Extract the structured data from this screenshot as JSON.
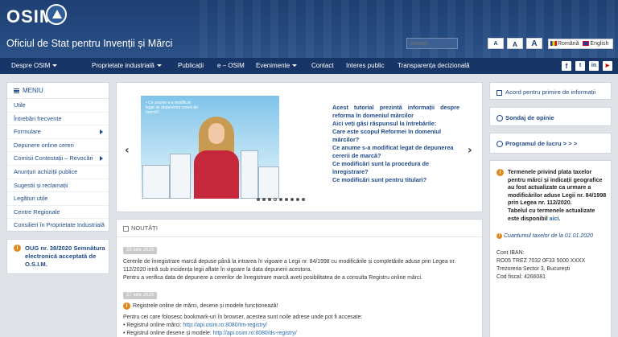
{
  "header": {
    "logo_text": "OSIM",
    "site_title": "Oficiul de Stat pentru Invenții și Mărci",
    "search_placeholder": "Search",
    "font_sizes": [
      "A",
      "A",
      "A"
    ],
    "languages": [
      "Română",
      "English"
    ]
  },
  "nav": {
    "items": [
      {
        "label": "Despre OSIM",
        "dropdown": true
      },
      {
        "label": "Proprietate industrială",
        "dropdown": true
      },
      {
        "label": "Publicații",
        "dropdown": false
      },
      {
        "label": "e – OSIM",
        "dropdown": false
      },
      {
        "label": "Evenimente",
        "dropdown": true
      },
      {
        "label": "Contact",
        "dropdown": false
      },
      {
        "label": "Interes public",
        "dropdown": false
      },
      {
        "label": "Transparența decizională",
        "dropdown": false
      }
    ],
    "social": [
      "f",
      "t",
      "in",
      "▶"
    ]
  },
  "menu": {
    "title": "MENIU",
    "items": [
      "Utile",
      "Întrebări frecvente",
      "Formulare",
      "Depunere online cereri",
      "Comisii Contestații – Revocări",
      "Anunțuri achiziții publice",
      "Sugestii și reclamații",
      "Legături utile",
      "Centre Regionale",
      "Consilieri în Proprietate Industrială"
    ]
  },
  "oug": {
    "text": "OUG nr. 38/2020 Semnătura electronică acceptată de O.S.I.M."
  },
  "slider": {
    "caption": "• Ce anume s-a modificat legat de depunerea cererii de marcă?",
    "lines": [
      "Acest tutorial prezintă informații despre reforma în domeniul mărcilor",
      "Aici veți găsi răspunsul la întrebările:",
      "Care este scopul Reformei în domeniul mărcilor?",
      "Ce anume s-a modificat legat de depunerea cererii de marcă?",
      "Ce modificări sunt la procedura de înregistrare?",
      "Ce modificări sunt pentru titulari?"
    ],
    "dot_count": 9,
    "active_dot": 3
  },
  "news": {
    "title": "NOUTĂȚI",
    "items": [
      {
        "date": "28 iulie 2020",
        "text1": "Cererile de înregistrare marcă depuse până la intrarea în vigoare a Legii nr. 84/1998 cu modificările și completările aduse prin Legea nr. 112/2020 intră sub incidența legii aflate în vigoare la data depunerii acestora.",
        "text2": "Pentru a verifica data de depunere a cererilor de înregistrare marcă aveți posibilitatea de a consulta Registru online mărci."
      },
      {
        "date": "27 iulie 2020",
        "headline": "Registrele online de mărci, desene și modele funcționează!",
        "text": "Pentru cei care folosesc bookmark-uri în browser, acestea sunt noile adrese unde pot fi accesate:",
        "links": [
          {
            "label": "• Registrul online mărci: ",
            "url": "http://api.osim.ro:8080/tm-registry/"
          },
          {
            "label": "• Registrul online desene și modele: ",
            "url": "http://api.osim.ro:8080/ds-registry/"
          }
        ]
      }
    ]
  },
  "right": {
    "acord": "Acord pentru primire de informații",
    "sondaj": "Sondaj de opinie",
    "program": "Programul de lucru   > > >",
    "termene_text": "Termenele privind plata taxelor pentru mărci și indicații geografice au fost actualizate ca urmare a modificărilor aduse Legii nr. 84/1998 prin Legea nr. 112/2020.",
    "termene_text2": "Tabelul cu termenele actualizate este disponibil",
    "termene_link": "aici.",
    "cuantum": "Cuantumul taxelor de la 01.01.2020",
    "iban": [
      "Cont IBAN:",
      "RO05 TREZ 7032 0F33 5000 XXXX",
      "Trezoreria Sector 3, București",
      "Cod fiscal: 4266081"
    ]
  },
  "colors": {
    "header": "#1f3f73",
    "nav": "#173566",
    "link": "#1f4a8a",
    "accent": "#e08a1e"
  }
}
